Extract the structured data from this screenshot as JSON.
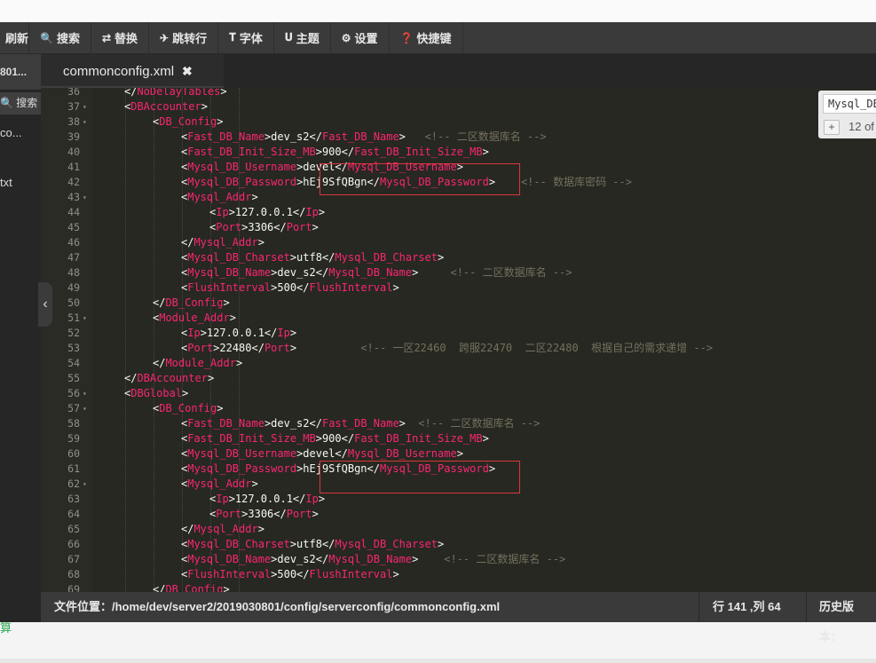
{
  "toolbar": {
    "items": [
      {
        "label": "刷新",
        "icon": "refresh-icon"
      },
      {
        "label": "搜索",
        "icon": "search-icon",
        "glyph": "🔍"
      },
      {
        "label": "替换",
        "icon": "replace-icon",
        "glyph": "⇄"
      },
      {
        "label": "跳转行",
        "icon": "goto-line-icon",
        "glyph": "✈"
      },
      {
        "label": "字体",
        "icon": "font-icon",
        "glyph": "𝐓"
      },
      {
        "label": "主题",
        "icon": "theme-icon",
        "glyph": "𝐔"
      },
      {
        "label": "设置",
        "icon": "gear-icon",
        "glyph": "⚙"
      },
      {
        "label": "快捷键",
        "icon": "help-icon",
        "glyph": "❓"
      }
    ]
  },
  "sidebar": {
    "current_file": "801...",
    "search_label": "搜索",
    "items": [
      "co...",
      "txt"
    ]
  },
  "tab": {
    "filename": "commonconfig.xml",
    "close_glyph": "✖"
  },
  "search_panel": {
    "query": "Mysql_DB",
    "add_label": "+",
    "count": "12 of"
  },
  "status": {
    "file_path": "文件位置：/home/dev/server2/2019030801/config/serverconfig/commonconfig.xml",
    "cursor": "行 141 ,列 64",
    "history": "历史版本："
  },
  "bottom_text": "算",
  "editor": {
    "lines": [
      {
        "n": "36",
        "fold": false,
        "indent": 4,
        "tokens": [
          [
            "b",
            "</"
          ],
          [
            "t",
            "NoDelayTables"
          ],
          [
            "b",
            ">"
          ]
        ]
      },
      {
        "n": "37",
        "fold": true,
        "indent": 4,
        "tokens": [
          [
            "b",
            "<"
          ],
          [
            "t",
            "DBAccounter"
          ],
          [
            "b",
            ">"
          ]
        ]
      },
      {
        "n": "38",
        "fold": true,
        "indent": 8,
        "tokens": [
          [
            "b",
            "<"
          ],
          [
            "t",
            "DB_Config"
          ],
          [
            "b",
            ">"
          ]
        ]
      },
      {
        "n": "39",
        "fold": false,
        "indent": 12,
        "tokens": [
          [
            "b",
            "<"
          ],
          [
            "t",
            "Fast_DB_Name"
          ],
          [
            "b",
            ">dev_s2</"
          ],
          [
            "t",
            "Fast_DB_Name"
          ],
          [
            "b",
            ">"
          ],
          [
            "c",
            "   <!-- 二区数据库名 -->"
          ]
        ]
      },
      {
        "n": "40",
        "fold": false,
        "indent": 12,
        "tokens": [
          [
            "b",
            "<"
          ],
          [
            "t",
            "Fast_DB_Init_Size_MB"
          ],
          [
            "b",
            ">900</"
          ],
          [
            "t",
            "Fast_DB_Init_Size_MB"
          ],
          [
            "b",
            ">"
          ]
        ]
      },
      {
        "n": "41",
        "fold": false,
        "indent": 12,
        "tokens": [
          [
            "b",
            "<"
          ],
          [
            "t",
            "Mysql_DB_Username"
          ],
          [
            "b",
            ">devel</"
          ],
          [
            "t",
            "Mysql_DB_Username"
          ],
          [
            "b",
            ">"
          ]
        ]
      },
      {
        "n": "42",
        "fold": false,
        "indent": 12,
        "tokens": [
          [
            "b",
            "<"
          ],
          [
            "t",
            "Mysql_DB_Password"
          ],
          [
            "b",
            ">hEj9SfQBgn</"
          ],
          [
            "t",
            "Mysql_DB_Password"
          ],
          [
            "b",
            ">"
          ],
          [
            "c",
            "    <!-- 数据库密码 -->"
          ]
        ]
      },
      {
        "n": "43",
        "fold": true,
        "indent": 12,
        "tokens": [
          [
            "b",
            "<"
          ],
          [
            "t",
            "Mysql_Addr"
          ],
          [
            "b",
            ">"
          ]
        ]
      },
      {
        "n": "44",
        "fold": false,
        "indent": 16,
        "tokens": [
          [
            "b",
            "<"
          ],
          [
            "t",
            "Ip"
          ],
          [
            "b",
            ">127.0.0.1</"
          ],
          [
            "t",
            "Ip"
          ],
          [
            "b",
            ">"
          ]
        ]
      },
      {
        "n": "45",
        "fold": false,
        "indent": 16,
        "tokens": [
          [
            "b",
            "<"
          ],
          [
            "t",
            "Port"
          ],
          [
            "b",
            ">3306</"
          ],
          [
            "t",
            "Port"
          ],
          [
            "b",
            ">"
          ]
        ]
      },
      {
        "n": "46",
        "fold": false,
        "indent": 12,
        "tokens": [
          [
            "b",
            "</"
          ],
          [
            "t",
            "Mysql_Addr"
          ],
          [
            "b",
            ">"
          ]
        ]
      },
      {
        "n": "47",
        "fold": false,
        "indent": 12,
        "tokens": [
          [
            "b",
            "<"
          ],
          [
            "t",
            "Mysql_DB_Charset"
          ],
          [
            "b",
            ">utf8</"
          ],
          [
            "t",
            "Mysql_DB_Charset"
          ],
          [
            "b",
            ">"
          ]
        ]
      },
      {
        "n": "48",
        "fold": false,
        "indent": 12,
        "tokens": [
          [
            "b",
            "<"
          ],
          [
            "t",
            "Mysql_DB_Name"
          ],
          [
            "b",
            ">dev_s2</"
          ],
          [
            "t",
            "Mysql_DB_Name"
          ],
          [
            "b",
            ">"
          ],
          [
            "c",
            "     <!-- 二区数据库名 -->"
          ]
        ]
      },
      {
        "n": "49",
        "fold": false,
        "indent": 12,
        "tokens": [
          [
            "b",
            "<"
          ],
          [
            "t",
            "FlushInterval"
          ],
          [
            "b",
            ">500</"
          ],
          [
            "t",
            "FlushInterval"
          ],
          [
            "b",
            ">"
          ]
        ]
      },
      {
        "n": "50",
        "fold": false,
        "indent": 8,
        "tokens": [
          [
            "b",
            "</"
          ],
          [
            "t",
            "DB_Config"
          ],
          [
            "b",
            ">"
          ]
        ]
      },
      {
        "n": "51",
        "fold": true,
        "indent": 8,
        "tokens": [
          [
            "b",
            "<"
          ],
          [
            "t",
            "Module_Addr"
          ],
          [
            "b",
            ">"
          ]
        ]
      },
      {
        "n": "52",
        "fold": false,
        "indent": 12,
        "tokens": [
          [
            "b",
            "<"
          ],
          [
            "t",
            "Ip"
          ],
          [
            "b",
            ">127.0.0.1</"
          ],
          [
            "t",
            "Ip"
          ],
          [
            "b",
            ">"
          ]
        ]
      },
      {
        "n": "53",
        "fold": false,
        "indent": 12,
        "tokens": [
          [
            "b",
            "<"
          ],
          [
            "t",
            "Port"
          ],
          [
            "b",
            ">22480</"
          ],
          [
            "t",
            "Port"
          ],
          [
            "b",
            ">"
          ],
          [
            "c",
            "          <!-- 一区22460  跨服22470  二区22480  根据自己的需求递增 -->"
          ]
        ]
      },
      {
        "n": "54",
        "fold": false,
        "indent": 8,
        "tokens": [
          [
            "b",
            "</"
          ],
          [
            "t",
            "Module_Addr"
          ],
          [
            "b",
            ">"
          ]
        ]
      },
      {
        "n": "55",
        "fold": false,
        "indent": 4,
        "tokens": [
          [
            "b",
            "</"
          ],
          [
            "t",
            "DBAccounter"
          ],
          [
            "b",
            ">"
          ]
        ]
      },
      {
        "n": "56",
        "fold": true,
        "indent": 4,
        "tokens": [
          [
            "b",
            "<"
          ],
          [
            "t",
            "DBGlobal"
          ],
          [
            "b",
            ">"
          ]
        ]
      },
      {
        "n": "57",
        "fold": true,
        "indent": 8,
        "tokens": [
          [
            "b",
            "<"
          ],
          [
            "t",
            "DB_Config"
          ],
          [
            "b",
            ">"
          ]
        ]
      },
      {
        "n": "58",
        "fold": false,
        "indent": 12,
        "tokens": [
          [
            "b",
            "<"
          ],
          [
            "t",
            "Fast_DB_Name"
          ],
          [
            "b",
            ">dev_s2</"
          ],
          [
            "t",
            "Fast_DB_Name"
          ],
          [
            "b",
            ">"
          ],
          [
            "c",
            "  <!-- 二区数据库名 -->"
          ]
        ]
      },
      {
        "n": "59",
        "fold": false,
        "indent": 12,
        "tokens": [
          [
            "b",
            "<"
          ],
          [
            "t",
            "Fast_DB_Init_Size_MB"
          ],
          [
            "b",
            ">900</"
          ],
          [
            "t",
            "Fast_DB_Init_Size_MB"
          ],
          [
            "b",
            ">"
          ]
        ]
      },
      {
        "n": "60",
        "fold": false,
        "indent": 12,
        "tokens": [
          [
            "b",
            "<"
          ],
          [
            "t",
            "Mysql_DB_Username"
          ],
          [
            "b",
            ">devel</"
          ],
          [
            "t",
            "Mysql_DB_Username"
          ],
          [
            "b",
            ">"
          ]
        ]
      },
      {
        "n": "61",
        "fold": false,
        "indent": 12,
        "tokens": [
          [
            "b",
            "<"
          ],
          [
            "t",
            "Mysql_DB_Password"
          ],
          [
            "b",
            ">hEj9SfQBgn</"
          ],
          [
            "t",
            "Mysql_DB_Password"
          ],
          [
            "b",
            ">"
          ]
        ]
      },
      {
        "n": "62",
        "fold": true,
        "indent": 12,
        "tokens": [
          [
            "b",
            "<"
          ],
          [
            "t",
            "Mysql_Addr"
          ],
          [
            "b",
            ">"
          ]
        ]
      },
      {
        "n": "63",
        "fold": false,
        "indent": 16,
        "tokens": [
          [
            "b",
            "<"
          ],
          [
            "t",
            "Ip"
          ],
          [
            "b",
            ">127.0.0.1</"
          ],
          [
            "t",
            "Ip"
          ],
          [
            "b",
            ">"
          ]
        ]
      },
      {
        "n": "64",
        "fold": false,
        "indent": 16,
        "tokens": [
          [
            "b",
            "<"
          ],
          [
            "t",
            "Port"
          ],
          [
            "b",
            ">3306</"
          ],
          [
            "t",
            "Port"
          ],
          [
            "b",
            ">"
          ]
        ]
      },
      {
        "n": "65",
        "fold": false,
        "indent": 12,
        "tokens": [
          [
            "b",
            "</"
          ],
          [
            "t",
            "Mysql_Addr"
          ],
          [
            "b",
            ">"
          ]
        ]
      },
      {
        "n": "66",
        "fold": false,
        "indent": 12,
        "tokens": [
          [
            "b",
            "<"
          ],
          [
            "t",
            "Mysql_DB_Charset"
          ],
          [
            "b",
            ">utf8</"
          ],
          [
            "t",
            "Mysql_DB_Charset"
          ],
          [
            "b",
            ">"
          ]
        ]
      },
      {
        "n": "67",
        "fold": false,
        "indent": 12,
        "tokens": [
          [
            "b",
            "<"
          ],
          [
            "t",
            "Mysql_DB_Name"
          ],
          [
            "b",
            ">dev_s2</"
          ],
          [
            "t",
            "Mysql_DB_Name"
          ],
          [
            "b",
            ">"
          ],
          [
            "c",
            "    <!-- 二区数据库名 -->"
          ]
        ]
      },
      {
        "n": "68",
        "fold": false,
        "indent": 12,
        "tokens": [
          [
            "b",
            "<"
          ],
          [
            "t",
            "FlushInterval"
          ],
          [
            "b",
            ">500</"
          ],
          [
            "t",
            "FlushInterval"
          ],
          [
            "b",
            ">"
          ]
        ]
      },
      {
        "n": "69",
        "fold": false,
        "indent": 8,
        "tokens": [
          [
            "b",
            "</"
          ],
          [
            "t",
            "DB_Config"
          ],
          [
            "b",
            ">"
          ]
        ]
      }
    ]
  },
  "colors": {
    "tag": "#f92672",
    "comment": "#75715e",
    "text": "#f8f8f2",
    "editor_bg": "#272822",
    "highlight_box": "#d9383c"
  }
}
